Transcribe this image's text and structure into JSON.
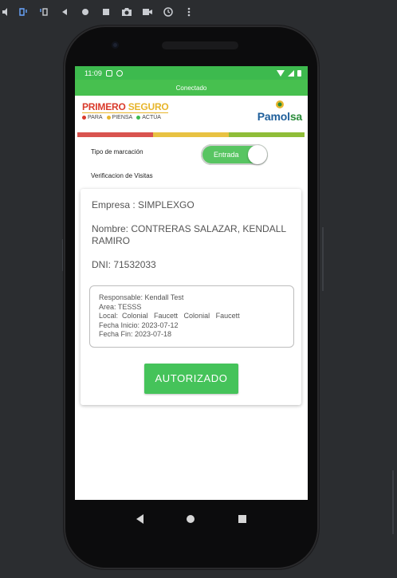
{
  "status_bar": {
    "time": "11:09"
  },
  "app_bar": {
    "title": "Conectado"
  },
  "brand": {
    "title_part1": "PRIMERO ",
    "title_part2": "SEGURO",
    "taglines": [
      "PARA",
      "PIENSA",
      "ACTÚA"
    ],
    "tagline_colors": [
      "#d93a2b",
      "#e7b52b",
      "#3dba4e"
    ],
    "logo_text_part1": "Pamol",
    "logo_text_part2": "sa"
  },
  "form": {
    "marking_type_label": "Tipo de marcación",
    "toggle_value": "Entrada",
    "section_label": "Verificacion de Visitas"
  },
  "visit_card": {
    "empresa": "Empresa : SIMPLEXGO",
    "nombre_line1": "Nombre: CONTRERAS SALAZAR, KENDALL",
    "nombre_line2": "RAMIRO",
    "dni": "DNI: 71532033",
    "details": {
      "responsable": "Responsable: Kendall Test",
      "area": "Area: TESSS",
      "local": "Local:  Colonial   Faucett   Colonial   Faucett",
      "fecha_inicio": "Fecha Inicio: 2023-07-12",
      "fecha_fin": "Fecha Fin: 2023-07-18"
    },
    "button_label": "AUTORIZADO"
  },
  "colors": {
    "accent_green": "#45c35a",
    "brand_red": "#d93a2b",
    "brand_yellow": "#e7b52b",
    "brand_blue": "#1f5f9b",
    "colorbar": [
      "#d9534f",
      "#e8c242",
      "#8fbd38"
    ]
  },
  "toolbar_icons": [
    "volume-icon",
    "rotate-left-icon",
    "rotate-right-icon",
    "back-icon",
    "home-icon",
    "overview-icon",
    "camera-icon",
    "video-icon",
    "replay-icon",
    "more-icon"
  ]
}
